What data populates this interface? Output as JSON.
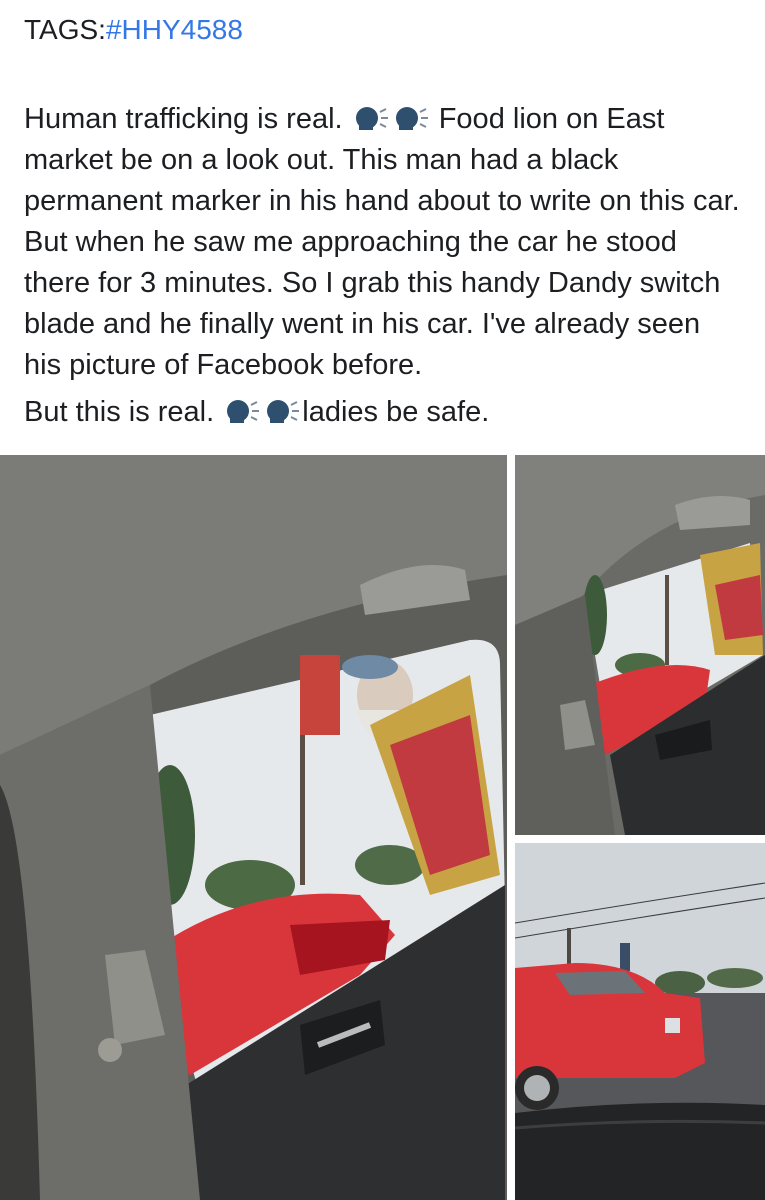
{
  "post": {
    "tags_label": "TAGS:",
    "tag": "#HHY4588",
    "lines": [
      "Human trafficking is real.",
      "Food lion on East market be on a look out. This man had a black permanent  marker in his hand about to write on this car. But when he saw me approaching the car he stood there for 3 minutes. So I grab this handy Dandy switch blade and he finally went in his car. I've already seen his picture of Facebook before.",
      "But this is real.",
      "ladies be safe."
    ]
  },
  "icons": {
    "speaking_head": "speaking-head-icon"
  },
  "colors": {
    "hashtag": "#3578e5",
    "text": "#1c1e21",
    "car_red": "#d9363b"
  }
}
